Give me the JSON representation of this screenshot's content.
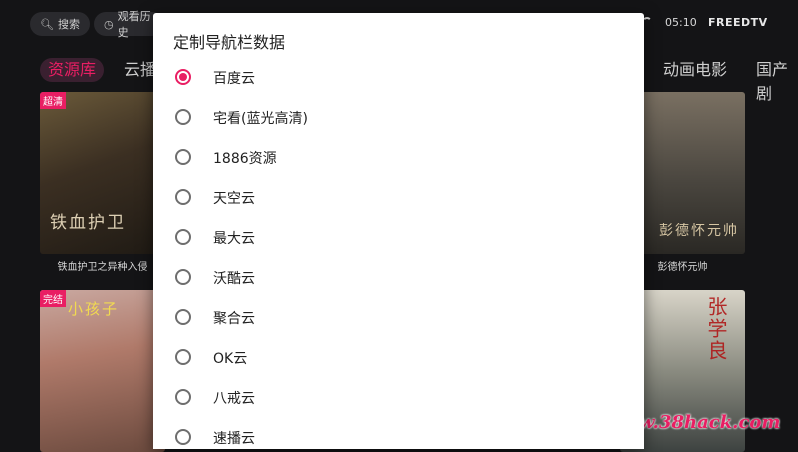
{
  "topbar": {
    "search_label": "搜索",
    "history_label": "观看历史",
    "time": "05:10",
    "brand": "FREEDTV"
  },
  "categories": [
    {
      "label": "资源库",
      "active": true
    },
    {
      "label": "云播"
    },
    {
      "label": "动画电影"
    },
    {
      "label": "国产剧"
    }
  ],
  "posters": [
    {
      "badge": "超清",
      "title": "铁血护卫之异种入侵",
      "art_text": "铁血护卫"
    },
    {
      "badge": "",
      "title": "彭德怀元帅",
      "art_text": "彭德怀元帅"
    },
    {
      "badge": "完结",
      "title": "",
      "art_text": "小孩子"
    },
    {
      "badge": "",
      "title": "",
      "art_text": "张学良"
    }
  ],
  "dialog": {
    "title": "定制导航栏数据",
    "options": [
      {
        "label": "百度云",
        "checked": true
      },
      {
        "label": "宅看(蓝光高清)",
        "checked": false
      },
      {
        "label": "1886资源",
        "checked": false
      },
      {
        "label": "天空云",
        "checked": false
      },
      {
        "label": "最大云",
        "checked": false
      },
      {
        "label": "沃酷云",
        "checked": false
      },
      {
        "label": "聚合云",
        "checked": false
      },
      {
        "label": "OK云",
        "checked": false
      },
      {
        "label": "八戒云",
        "checked": false
      },
      {
        "label": "速播云",
        "checked": false
      }
    ]
  },
  "watermark": "www.38hack.com",
  "colors": {
    "accent": "#e91e63",
    "background": "#141416",
    "dialog": "#ffffff"
  }
}
